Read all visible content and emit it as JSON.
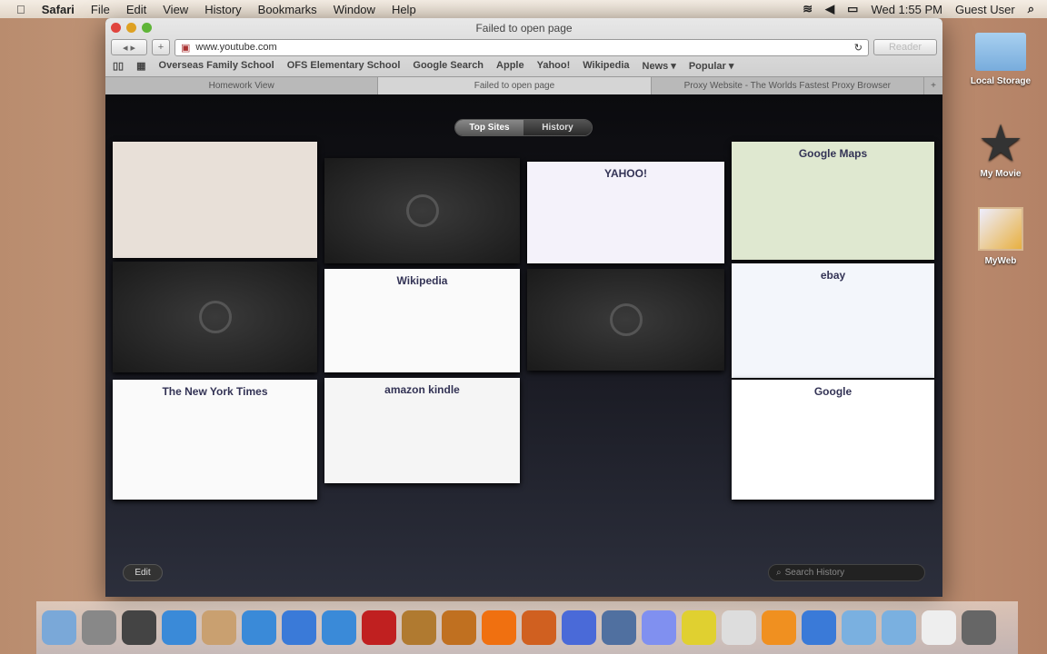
{
  "menubar": {
    "app": "Safari",
    "items": [
      "File",
      "Edit",
      "View",
      "History",
      "Bookmarks",
      "Window",
      "Help"
    ],
    "clock": "Wed 1:55 PM",
    "user": "Guest User"
  },
  "window": {
    "title": "Failed to open page",
    "url": "www.youtube.com",
    "reader": "Reader",
    "bookmarks": [
      "Overseas Family School",
      "OFS Elementary School",
      "Google Search",
      "Apple",
      "Yahoo!",
      "Wikipedia",
      "News ▾",
      "Popular ▾"
    ],
    "tabs": [
      "Homework View",
      "Failed to open page",
      "Proxy Website - The Worlds Fastest Proxy Browser"
    ],
    "segments": [
      "Top Sites",
      "History"
    ],
    "edit": "Edit",
    "search_placeholder": "Search History",
    "thumbs": [
      {
        "label": "",
        "color": "#e8e0d8"
      },
      {
        "label": "",
        "color": "empty"
      },
      {
        "label": "YAHOO!",
        "color": "#f4f2fa"
      },
      {
        "label": "Google Maps",
        "color": "#dfe8d0"
      },
      {
        "label": "",
        "color": "empty"
      },
      {
        "label": "Wikipedia",
        "color": "#fafafa"
      },
      {
        "label": "",
        "color": "empty"
      },
      {
        "label": "ebay",
        "color": "#f3f6fb"
      },
      {
        "label": "The New York Times",
        "color": "#fafafa"
      },
      {
        "label": "amazon kindle",
        "color": "#f5f5f5"
      },
      {
        "label": "Google",
        "color": "#ffffff"
      }
    ]
  },
  "desktop": [
    "Local Storage",
    "My Movie",
    "MyWeb"
  ],
  "dock_colors": [
    "#7aa8d8",
    "#888",
    "#444",
    "#3a8ad8",
    "#c9a070",
    "#3a8ad8",
    "#3a7ad8",
    "#3a8ad8",
    "#c02020",
    "#b07a30",
    "#c07020",
    "#f07010",
    "#d06020",
    "#4a6ad8",
    "#5070a0",
    "#8090f0",
    "#e0d030",
    "#ddd",
    "#f09020",
    "#3a7ad8",
    "#7ab0e0",
    "#7ab0e0",
    "#eee",
    "#666"
  ]
}
